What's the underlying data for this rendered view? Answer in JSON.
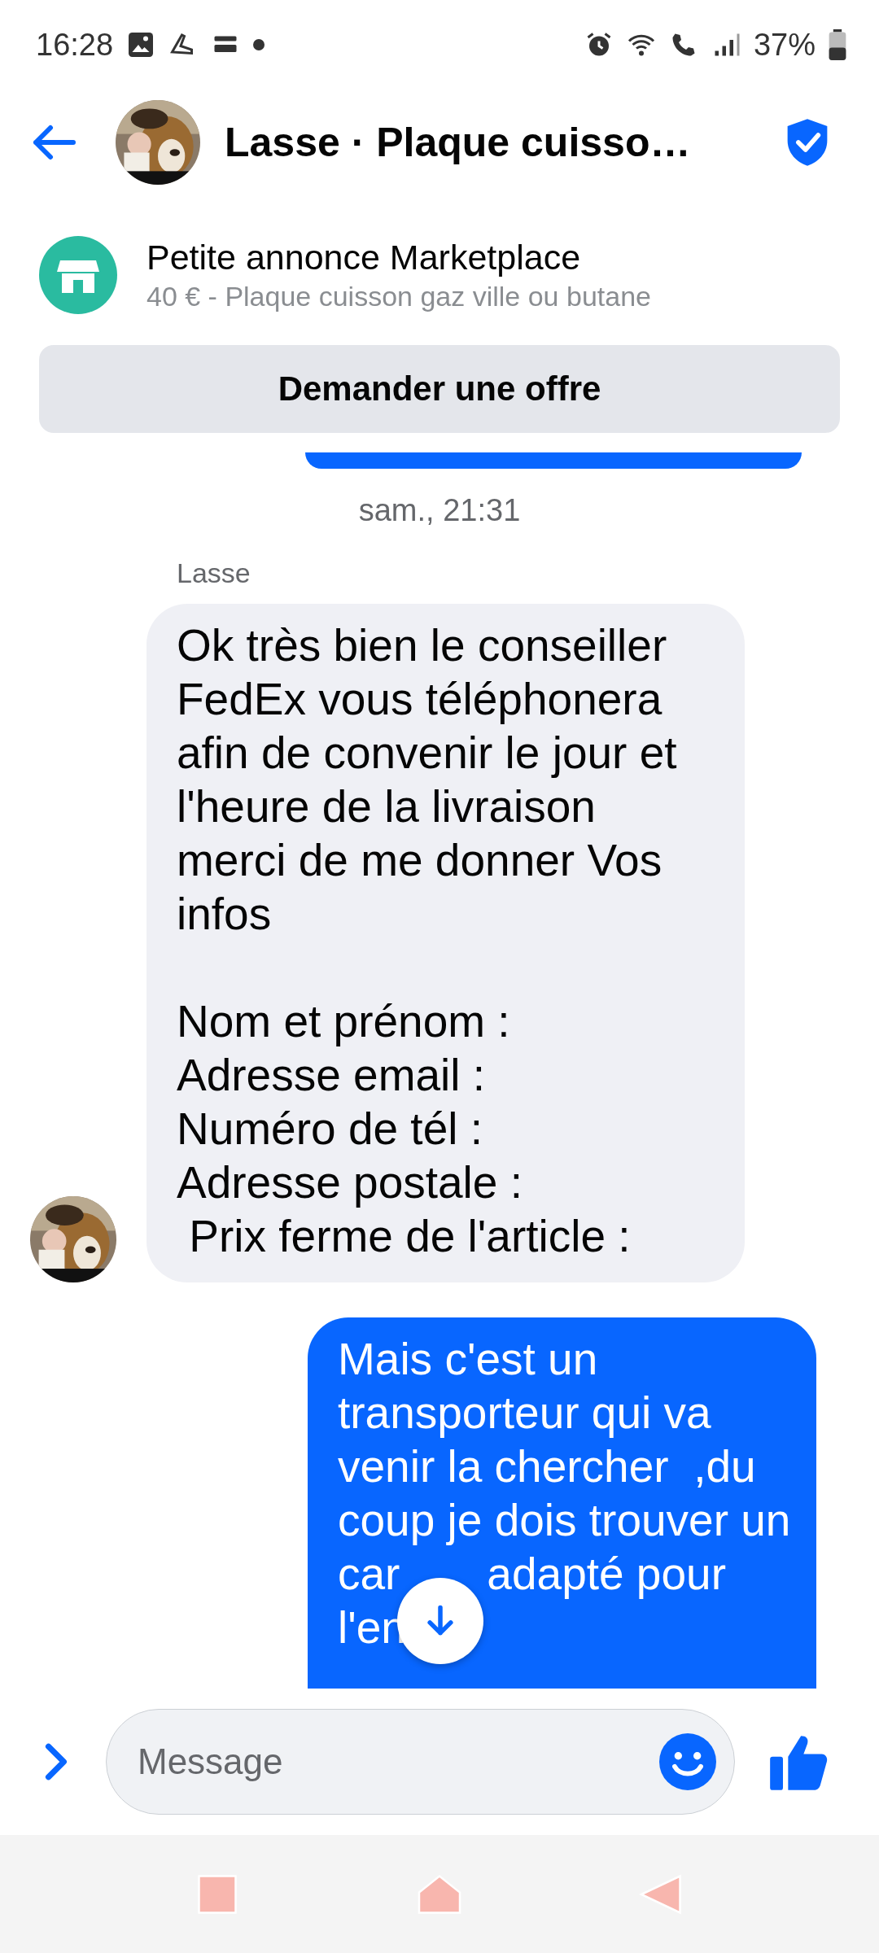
{
  "status_bar": {
    "time": "16:28",
    "battery": "37%"
  },
  "header": {
    "title": "Lasse · Plaque cuisso…"
  },
  "listing": {
    "title": "Petite annonce Marketplace",
    "subtitle": "40 € - Plaque cuisson gaz ville ou butane"
  },
  "offer_button": "Demander une offre",
  "timestamp": "sam., 21:31",
  "messages": [
    {
      "kind": "received",
      "sender": "Lasse",
      "text": "Ok très bien le conseiller FedEx vous téléphonera afin de convenir le jour et l'heure de la livraison merci de me donner Vos infos\n\nNom et prénom :\nAdresse email :\nNuméro de tél :\nAdresse postale :\n Prix ferme de l'article :"
    },
    {
      "kind": "sent",
      "text": "Mais c'est un transporteur qui va venir la chercher  ,du coup je dois trouver un car       adapté pour l'en"
    }
  ],
  "composer": {
    "placeholder": "Message"
  }
}
